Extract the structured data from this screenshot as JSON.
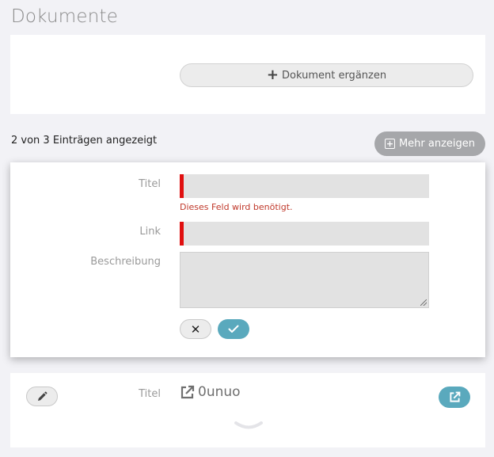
{
  "section": {
    "title": "Dokumente"
  },
  "add_panel": {
    "button_label": "Dokument ergänzen",
    "icon": "plus-icon"
  },
  "list": {
    "count_text": "2 von 3 Einträgen angezeigt",
    "more_button_label": "Mehr anzeigen"
  },
  "form": {
    "title_label": "Titel",
    "title_value": "",
    "title_error": "Dieses Feld wird benötigt.",
    "link_label": "Link",
    "link_value": "",
    "description_label": "Beschreibung",
    "description_value": ""
  },
  "item": {
    "label": "Titel",
    "link_text": "0unuo"
  },
  "colors": {
    "accent": "#5aa9bd",
    "required": "#e01010",
    "error_text": "#c0392b",
    "more_button": "#a6a7aa"
  }
}
